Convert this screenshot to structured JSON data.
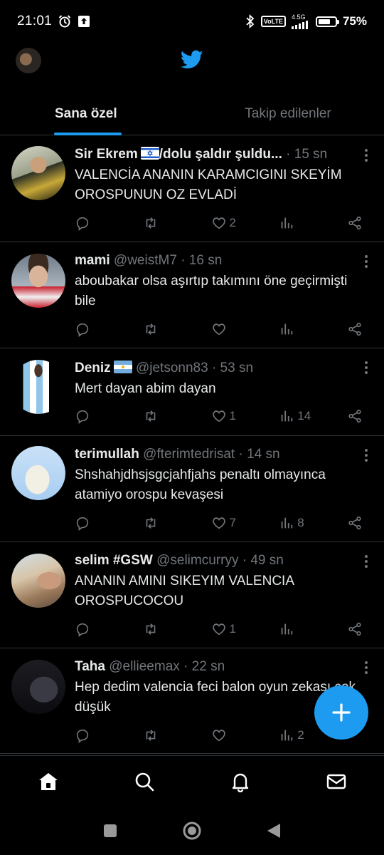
{
  "status_bar": {
    "time": "21:01",
    "network": "4.5G",
    "battery_pct": "75%",
    "battery_level": 0.75
  },
  "header": {
    "logo": "twitter-bird-icon",
    "brand_color": "#1d9bf0"
  },
  "tabs": [
    {
      "label": "Sana özel",
      "active": true
    },
    {
      "label": "Takip edilenler",
      "active": false
    }
  ],
  "tweets": [
    {
      "name": "Sir Ekrem",
      "flag": "israel-flag",
      "name_suffix": "/dolu şaldır şuldu...",
      "handle": "",
      "time": "· 15 sn",
      "text": "VALENCİA ANANIN KARAMCIGINI SKEYİM OROSPUNUN OZ EVLADİ",
      "replies": "",
      "retweets": "",
      "likes": "2",
      "views": ""
    },
    {
      "name": "mami",
      "handle": "@weistM7",
      "time": "· 16 sn",
      "text": "aboubakar olsa aşırtıp takımını öne geçirmişti bile",
      "replies": "",
      "retweets": "",
      "likes": "",
      "views": ""
    },
    {
      "name": "Deniz",
      "flag": "argentina-flag",
      "handle": "@jetsonn83",
      "time": "· 53 sn",
      "text": "Mert dayan abim dayan",
      "replies": "",
      "retweets": "",
      "likes": "1",
      "views": "14"
    },
    {
      "name": "terimullah",
      "handle": "@fterimtedrisat",
      "time": "· 14 sn",
      "text": "Shshahjdhsjsgcjahfjahs penaltı olmayınca atamiyo orospu kevaşesi",
      "replies": "",
      "retweets": "",
      "likes": "7",
      "views": "8"
    },
    {
      "name": "selim #GSW",
      "handle": "@selimcurryy",
      "time": "· 49 sn",
      "text": "ANANIN AMINI SIKEYIM VALENCIA OROSPUCOCOU",
      "replies": "",
      "retweets": "",
      "likes": "1",
      "views": ""
    },
    {
      "name": "Taha",
      "handle": "@ellieemax",
      "time": "· 22 sn",
      "text": "Hep dedim valencia feci balon oyun zekası çok düşük",
      "replies": "",
      "retweets": "",
      "likes": "",
      "views": "2"
    }
  ],
  "fab": {
    "icon": "plus-icon"
  },
  "bottom_nav": [
    "home-icon",
    "search-icon",
    "bell-icon",
    "mail-icon"
  ],
  "system_nav": [
    "recents-square-icon",
    "home-circle-icon",
    "back-triangle-icon"
  ]
}
